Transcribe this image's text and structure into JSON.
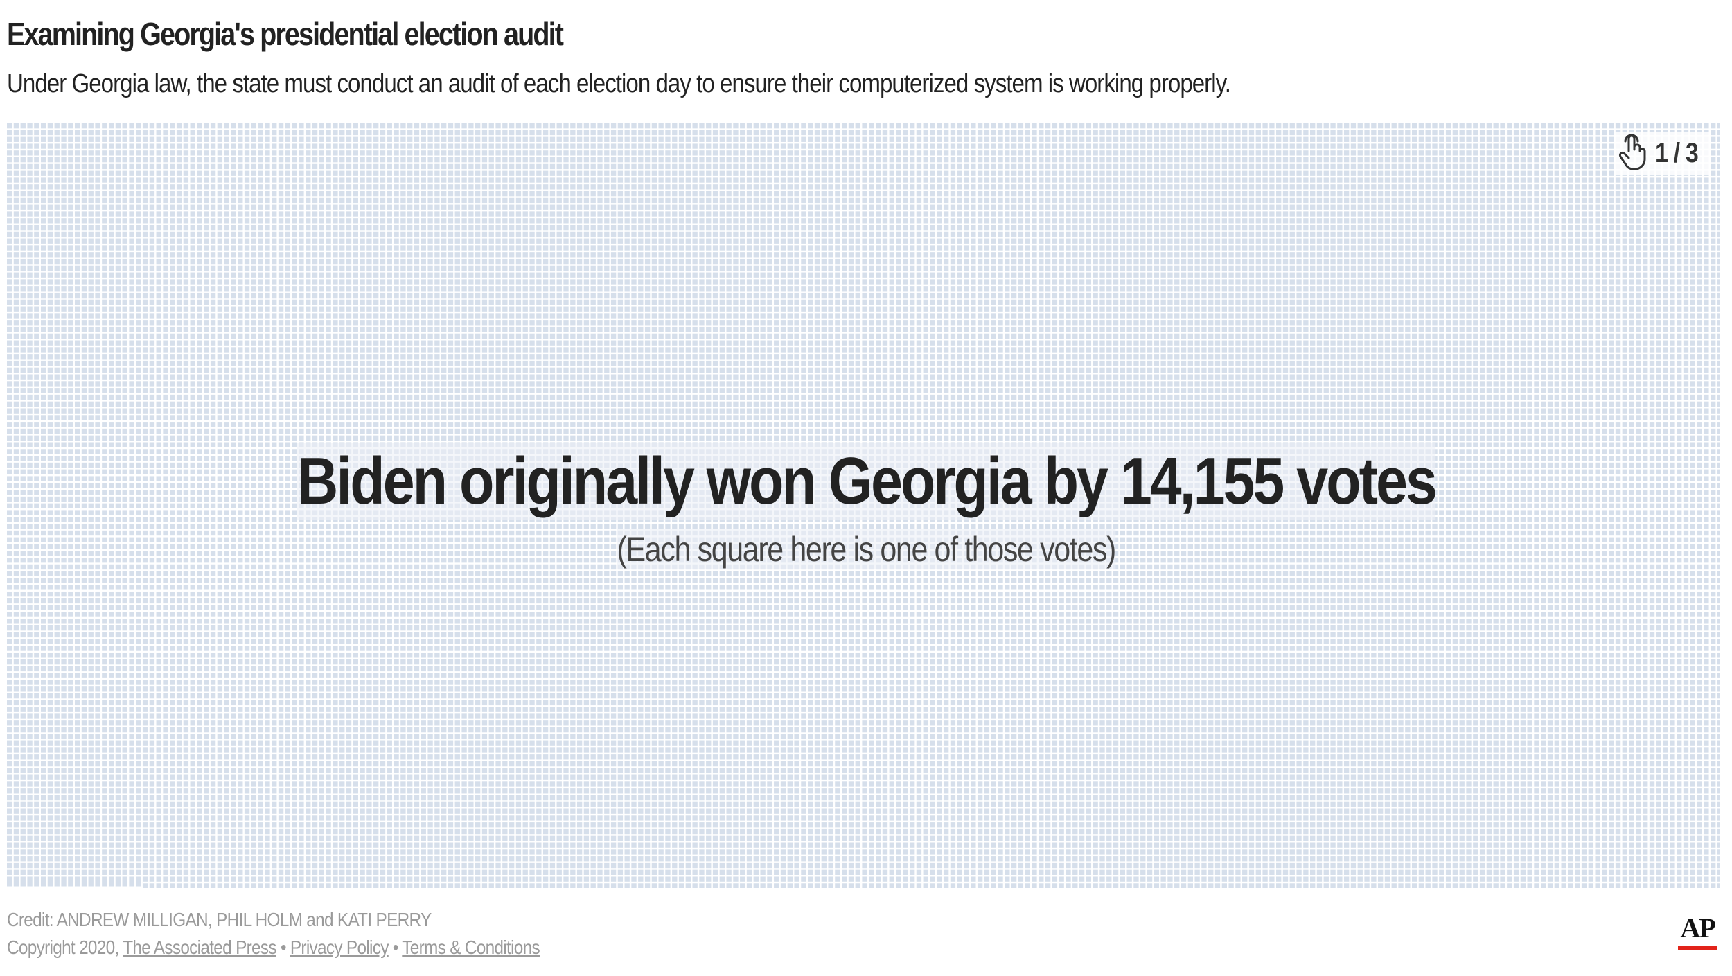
{
  "header": {
    "title": "Examining Georgia's presidential election audit",
    "subtitle": "Under Georgia law, the state must conduct an audit of each election day to ensure their computerized system is working properly."
  },
  "stepper": {
    "icon": "tap-hand-icon",
    "label": "1 / 3"
  },
  "slide": {
    "headline": "Biden originally won Georgia by 14,155 votes",
    "subhead": "(Each square here is one of those votes)",
    "square_count": 14155,
    "square_color": "#d6dfeb"
  },
  "footer": {
    "credit": "Credit: ANDREW MILLIGAN, PHIL HOLM and KATI PERRY",
    "copyright_prefix": "Copyright 2020,",
    "publisher_link": "The Associated Press",
    "separator": "•",
    "privacy_link": "Privacy Policy",
    "terms_link": "Terms & Conditions",
    "logo_text": "AP",
    "logo_accent": "#e2231a"
  }
}
